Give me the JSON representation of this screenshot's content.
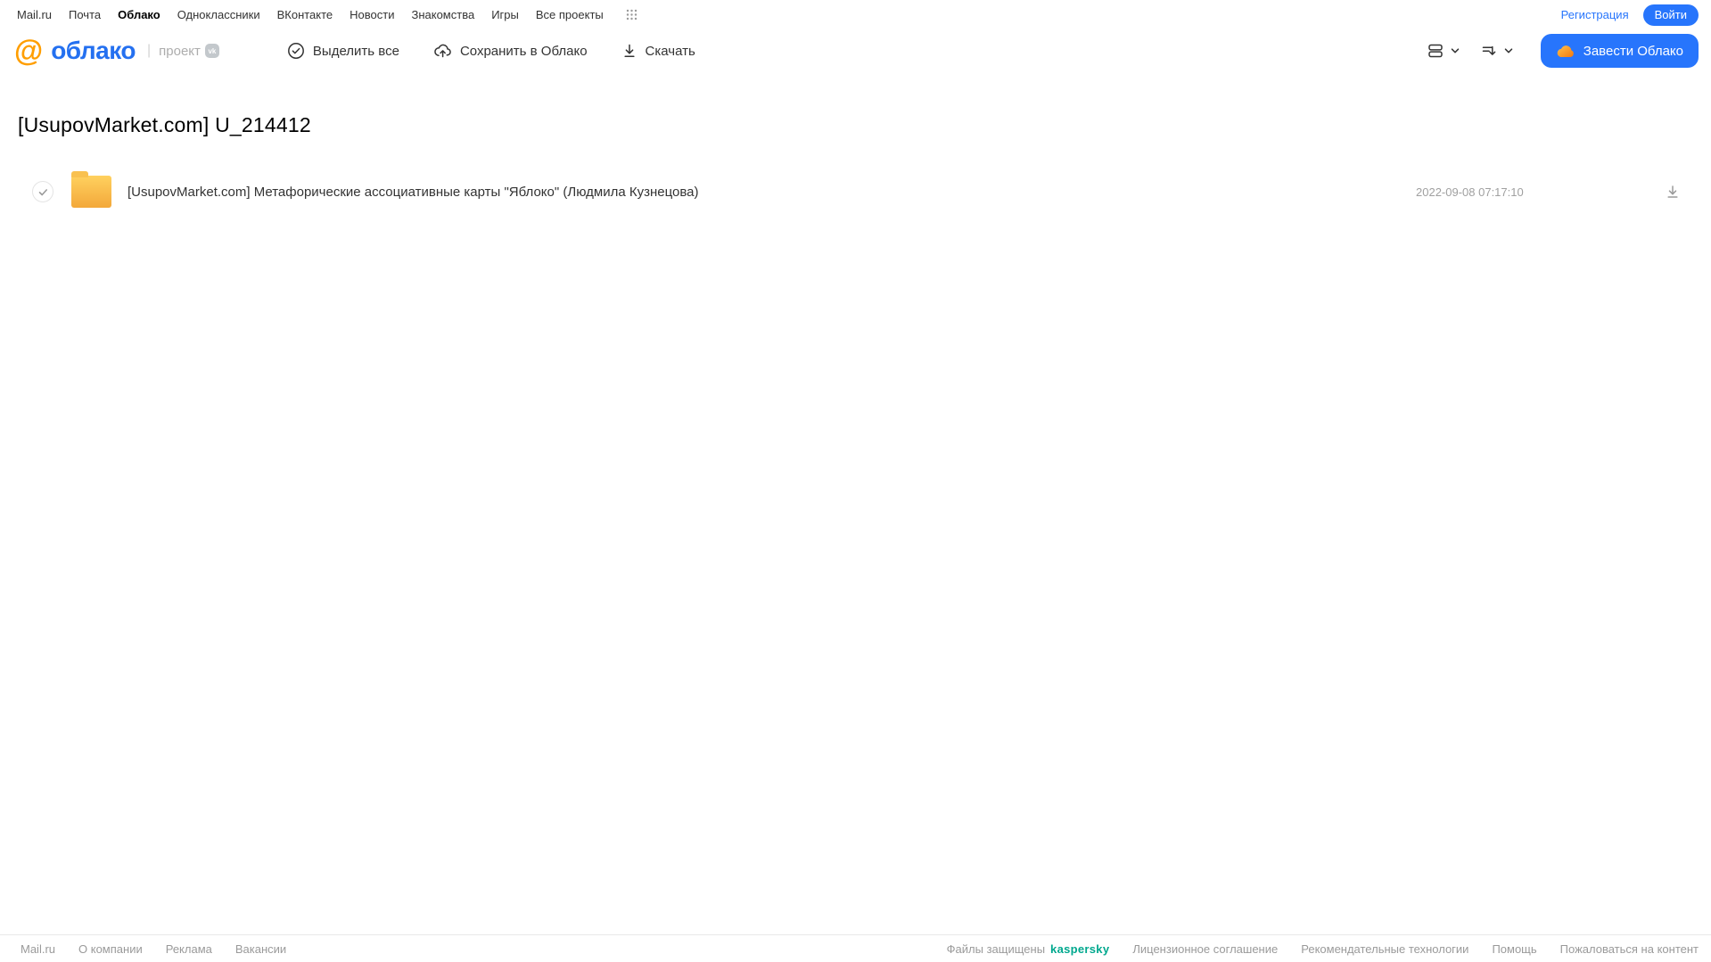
{
  "topnav": {
    "links": [
      "Mail.ru",
      "Почта",
      "Облако",
      "Одноклассники",
      "ВКонтакте",
      "Новости",
      "Знакомства",
      "Игры",
      "Все проекты"
    ],
    "registration": "Регистрация",
    "login": "Войти"
  },
  "header": {
    "logo": {
      "at": "@",
      "wordmark": "облако",
      "divider": "|",
      "project": "проект",
      "vk_badge": "vk"
    },
    "actions": {
      "select_all": "Выделить все",
      "save_to_cloud": "Сохранить в Облако",
      "download": "Скачать"
    },
    "create_cloud": "Завести Облако"
  },
  "main": {
    "title": "[UsupovMarket.com] U_214412",
    "files": [
      {
        "name": "[UsupovMarket.com] Метафорические ассоциативные карты \"Яблоко\" (Людмила Кузнецова)",
        "date": "2022-09-08 07:17:10"
      }
    ]
  },
  "footer": {
    "left": [
      "Mail.ru",
      "О компании",
      "Реклама",
      "Вакансии"
    ],
    "protected_label": "Файлы защищены",
    "kaspersky": "kaspersky",
    "right": [
      "Лицензионное соглашение",
      "Рекомендательные технологии",
      "Помощь",
      "Пожаловаться на контент"
    ]
  },
  "colors": {
    "accent_blue": "#2775fc",
    "logo_orange": "#ff9e00",
    "logo_blue": "#2470f0",
    "folder_top": "#ffd15f",
    "folder_bottom": "#f3a83a",
    "kaspersky_green": "#00a88e"
  }
}
